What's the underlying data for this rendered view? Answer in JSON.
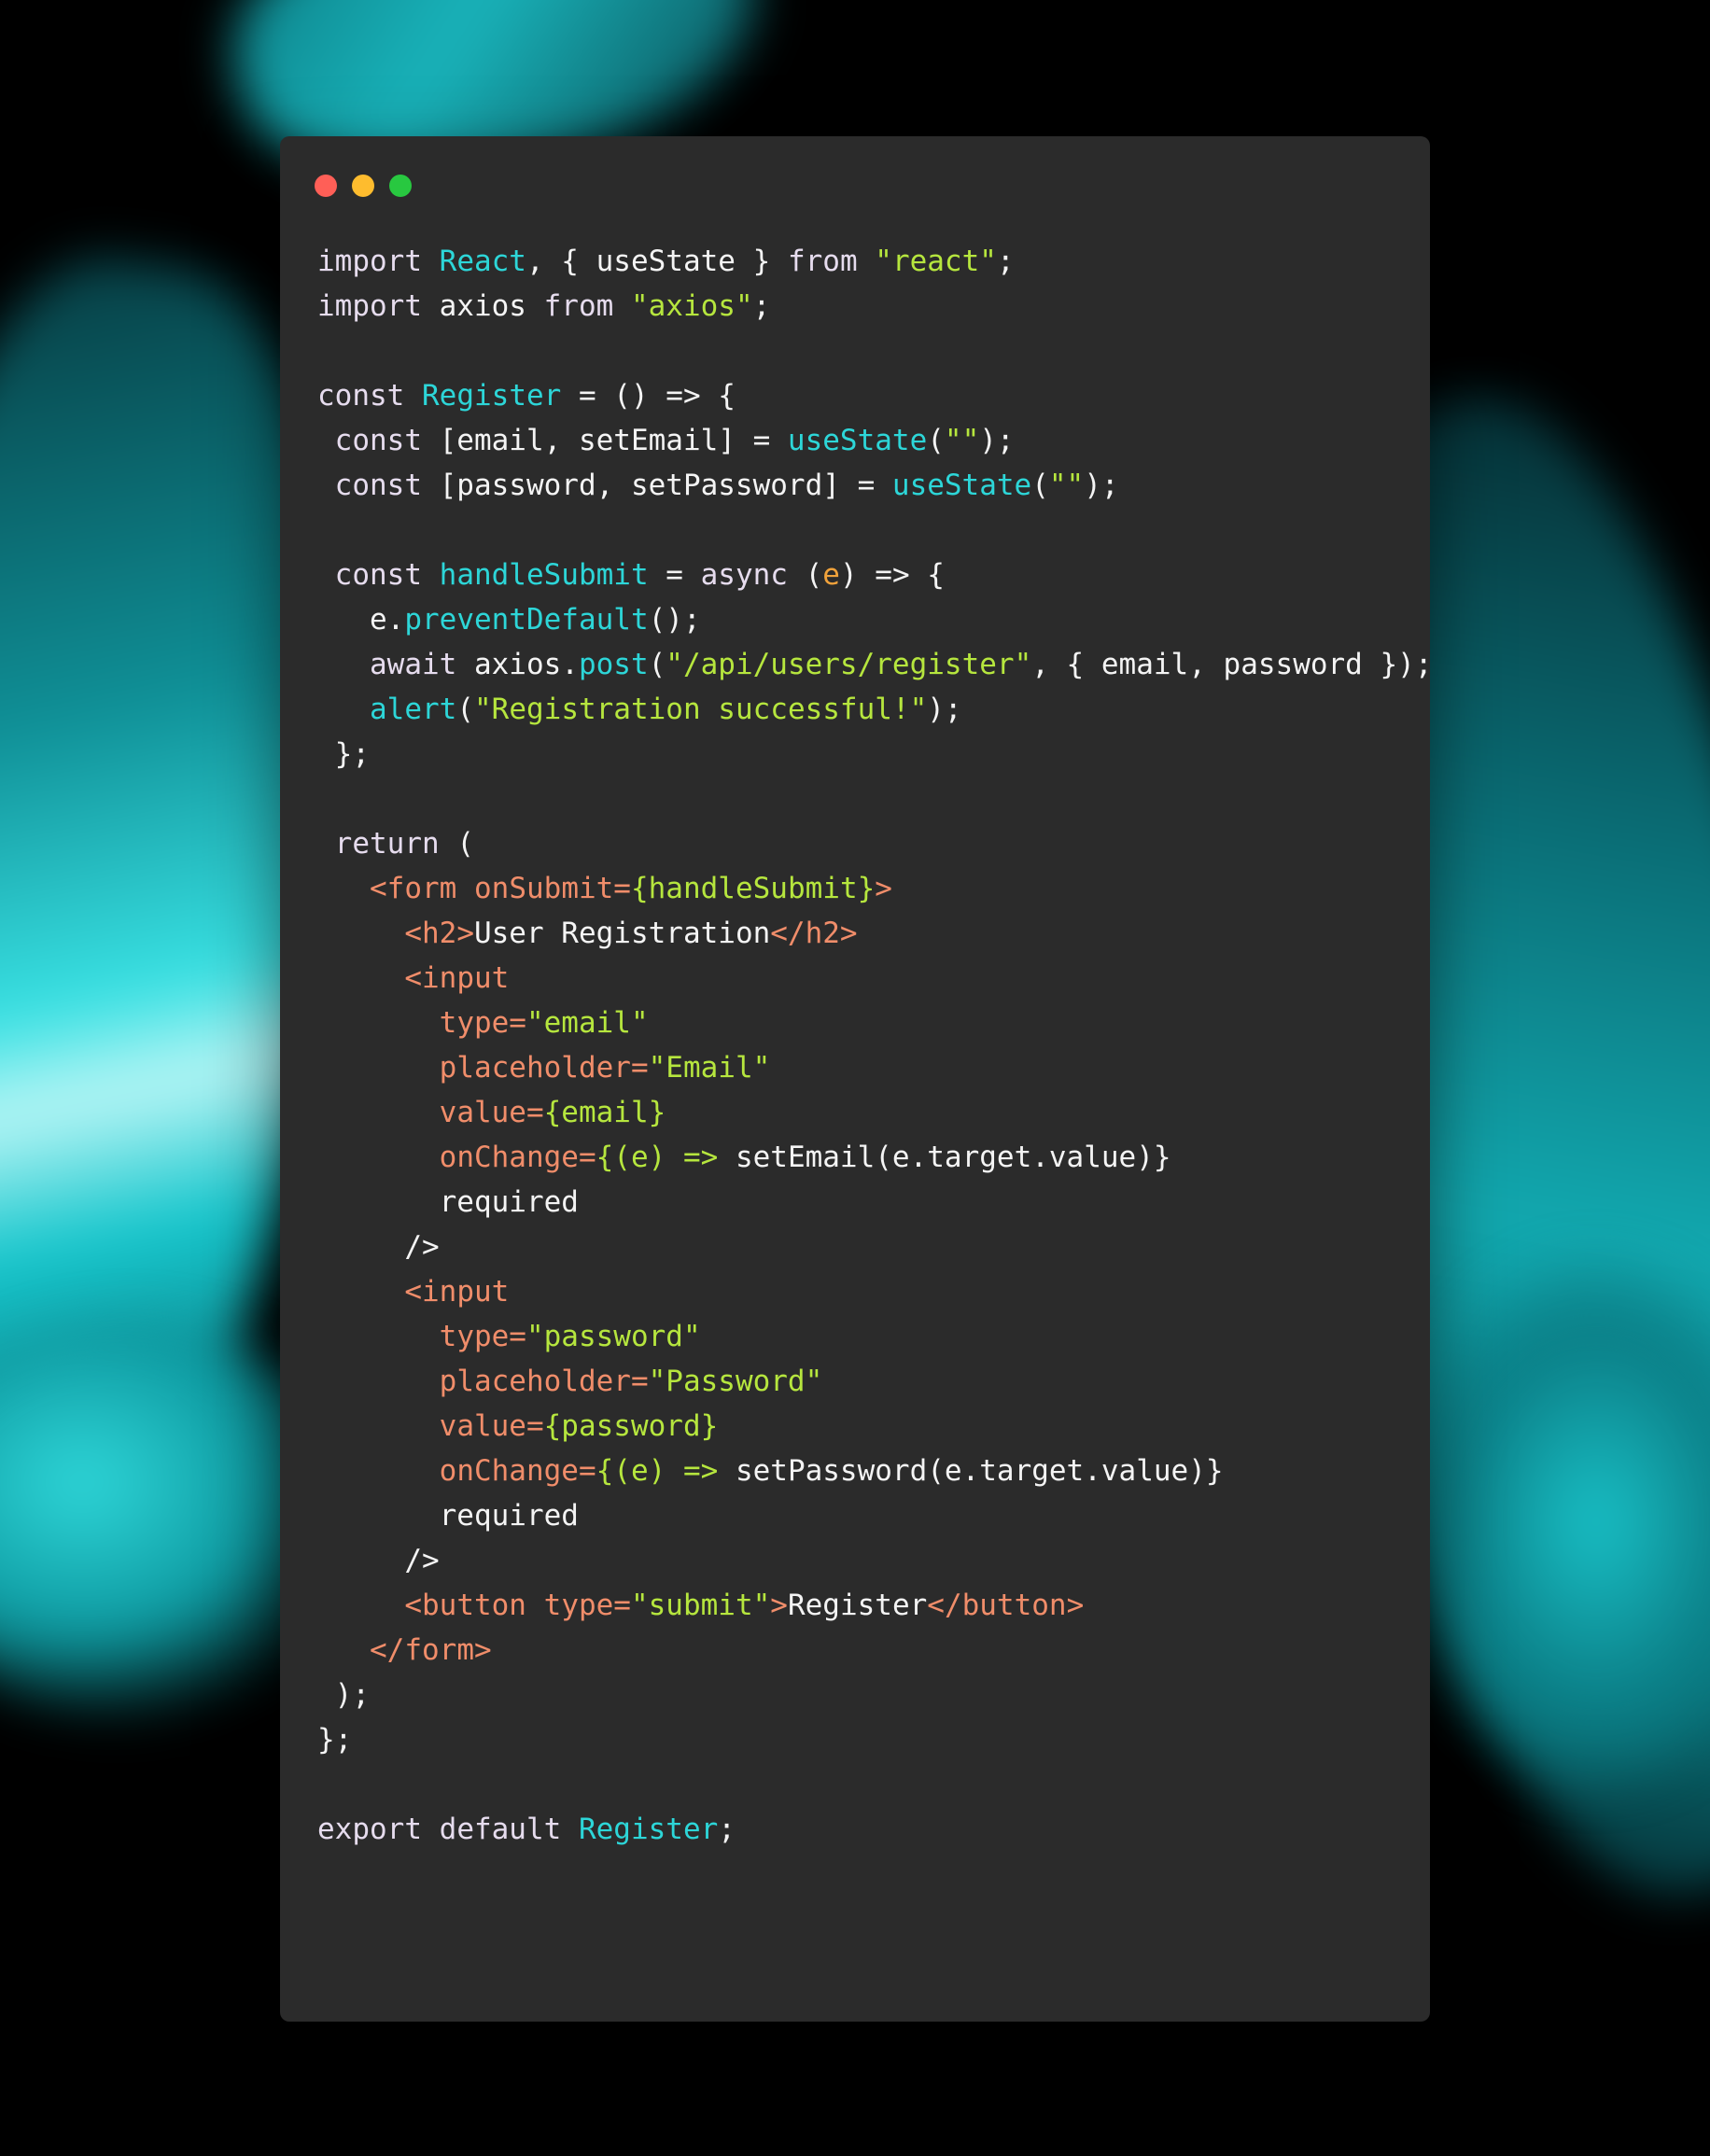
{
  "window": {
    "controls": [
      {
        "name": "close",
        "color": "#ff5f57"
      },
      {
        "name": "minimize",
        "color": "#febc2e"
      },
      {
        "name": "maximize",
        "color": "#28c840"
      }
    ]
  },
  "colors": {
    "background": "#2b2b2b",
    "keyword": "#e6dcee",
    "identifier_highlight": "#2dd6d8",
    "string": "#b6e63e",
    "parameter": "#f0a23b",
    "jsx_tag": "#f08d6a",
    "text": "#f4f4f4"
  },
  "code": {
    "lines": [
      [
        {
          "t": "import",
          "c": "kw"
        },
        {
          "t": " ",
          "c": "plain"
        },
        {
          "t": "React",
          "c": "cyan"
        },
        {
          "t": ", { useState } ",
          "c": "plain"
        },
        {
          "t": "from",
          "c": "kw"
        },
        {
          "t": " ",
          "c": "plain"
        },
        {
          "t": "\"react\"",
          "c": "str"
        },
        {
          "t": ";",
          "c": "plain"
        }
      ],
      [
        {
          "t": "import",
          "c": "kw"
        },
        {
          "t": " axios ",
          "c": "plain"
        },
        {
          "t": "from",
          "c": "kw"
        },
        {
          "t": " ",
          "c": "plain"
        },
        {
          "t": "\"axios\"",
          "c": "str"
        },
        {
          "t": ";",
          "c": "plain"
        }
      ],
      [],
      [
        {
          "t": "const",
          "c": "kw"
        },
        {
          "t": " ",
          "c": "plain"
        },
        {
          "t": "Register",
          "c": "cyan"
        },
        {
          "t": " = () => {",
          "c": "plain"
        }
      ],
      [
        {
          "t": " const",
          "c": "kw"
        },
        {
          "t": " [email, setEmail] = ",
          "c": "plain"
        },
        {
          "t": "useState",
          "c": "cyan"
        },
        {
          "t": "(",
          "c": "plain"
        },
        {
          "t": "\"\"",
          "c": "str"
        },
        {
          "t": ");",
          "c": "plain"
        }
      ],
      [
        {
          "t": " const",
          "c": "kw"
        },
        {
          "t": " [password, setPassword] = ",
          "c": "plain"
        },
        {
          "t": "useState",
          "c": "cyan"
        },
        {
          "t": "(",
          "c": "plain"
        },
        {
          "t": "\"\"",
          "c": "str"
        },
        {
          "t": ");",
          "c": "plain"
        }
      ],
      [],
      [
        {
          "t": " const",
          "c": "kw"
        },
        {
          "t": " ",
          "c": "plain"
        },
        {
          "t": "handleSubmit",
          "c": "cyan"
        },
        {
          "t": " = ",
          "c": "plain"
        },
        {
          "t": "async",
          "c": "kw"
        },
        {
          "t": " (",
          "c": "plain"
        },
        {
          "t": "e",
          "c": "param"
        },
        {
          "t": ") => {",
          "c": "plain"
        }
      ],
      [
        {
          "t": "   e.",
          "c": "plain"
        },
        {
          "t": "preventDefault",
          "c": "cyan"
        },
        {
          "t": "();",
          "c": "plain"
        }
      ],
      [
        {
          "t": "   await",
          "c": "kw"
        },
        {
          "t": " axios.",
          "c": "plain"
        },
        {
          "t": "post",
          "c": "cyan"
        },
        {
          "t": "(",
          "c": "plain"
        },
        {
          "t": "\"/api/users/register\"",
          "c": "str"
        },
        {
          "t": ", { email, password });",
          "c": "plain"
        }
      ],
      [
        {
          "t": "   ",
          "c": "plain"
        },
        {
          "t": "alert",
          "c": "cyan"
        },
        {
          "t": "(",
          "c": "plain"
        },
        {
          "t": "\"Registration successful!\"",
          "c": "str"
        },
        {
          "t": ");",
          "c": "plain"
        }
      ],
      [
        {
          "t": " };",
          "c": "plain"
        }
      ],
      [],
      [
        {
          "t": " return",
          "c": "kw"
        },
        {
          "t": " (",
          "c": "plain"
        }
      ],
      [
        {
          "t": "   ",
          "c": "plain"
        },
        {
          "t": "<form",
          "c": "tag"
        },
        {
          "t": " ",
          "c": "plain"
        },
        {
          "t": "onSubmit=",
          "c": "attr"
        },
        {
          "t": "{handleSubmit}",
          "c": "aval"
        },
        {
          "t": ">",
          "c": "tag"
        }
      ],
      [
        {
          "t": "     ",
          "c": "plain"
        },
        {
          "t": "<h2>",
          "c": "tag"
        },
        {
          "t": "User Registration",
          "c": "plain"
        },
        {
          "t": "</h2>",
          "c": "tag"
        }
      ],
      [
        {
          "t": "     ",
          "c": "plain"
        },
        {
          "t": "<input",
          "c": "tag"
        }
      ],
      [
        {
          "t": "       ",
          "c": "plain"
        },
        {
          "t": "type=",
          "c": "attr"
        },
        {
          "t": "\"email\"",
          "c": "aval"
        }
      ],
      [
        {
          "t": "       ",
          "c": "plain"
        },
        {
          "t": "placeholder=",
          "c": "attr"
        },
        {
          "t": "\"Email\"",
          "c": "aval"
        }
      ],
      [
        {
          "t": "       ",
          "c": "plain"
        },
        {
          "t": "value=",
          "c": "attr"
        },
        {
          "t": "{email}",
          "c": "aval"
        }
      ],
      [
        {
          "t": "       ",
          "c": "plain"
        },
        {
          "t": "onChange=",
          "c": "attr"
        },
        {
          "t": "{(e) => ",
          "c": "aval"
        },
        {
          "t": "setEmail(e.target.value)}",
          "c": "plain"
        }
      ],
      [
        {
          "t": "       required",
          "c": "plain"
        }
      ],
      [
        {
          "t": "     />",
          "c": "plain"
        }
      ],
      [
        {
          "t": "     ",
          "c": "plain"
        },
        {
          "t": "<input",
          "c": "tag"
        }
      ],
      [
        {
          "t": "       ",
          "c": "plain"
        },
        {
          "t": "type=",
          "c": "attr"
        },
        {
          "t": "\"password\"",
          "c": "aval"
        }
      ],
      [
        {
          "t": "       ",
          "c": "plain"
        },
        {
          "t": "placeholder=",
          "c": "attr"
        },
        {
          "t": "\"Password\"",
          "c": "aval"
        }
      ],
      [
        {
          "t": "       ",
          "c": "plain"
        },
        {
          "t": "value=",
          "c": "attr"
        },
        {
          "t": "{password}",
          "c": "aval"
        }
      ],
      [
        {
          "t": "       ",
          "c": "plain"
        },
        {
          "t": "onChange=",
          "c": "attr"
        },
        {
          "t": "{(e) => ",
          "c": "aval"
        },
        {
          "t": "setPassword(e.target.value)}",
          "c": "plain"
        }
      ],
      [
        {
          "t": "       required",
          "c": "plain"
        }
      ],
      [
        {
          "t": "     />",
          "c": "plain"
        }
      ],
      [
        {
          "t": "     ",
          "c": "plain"
        },
        {
          "t": "<button",
          "c": "tag"
        },
        {
          "t": " ",
          "c": "plain"
        },
        {
          "t": "type=",
          "c": "attr"
        },
        {
          "t": "\"submit\"",
          "c": "aval"
        },
        {
          "t": ">",
          "c": "tag"
        },
        {
          "t": "Register",
          "c": "plain"
        },
        {
          "t": "</button>",
          "c": "tag"
        }
      ],
      [
        {
          "t": "   ",
          "c": "plain"
        },
        {
          "t": "</form>",
          "c": "tag"
        }
      ],
      [
        {
          "t": " );",
          "c": "plain"
        }
      ],
      [
        {
          "t": "};",
          "c": "plain"
        }
      ],
      [],
      [
        {
          "t": "export",
          "c": "kw"
        },
        {
          "t": " ",
          "c": "plain"
        },
        {
          "t": "default",
          "c": "kw"
        },
        {
          "t": " ",
          "c": "plain"
        },
        {
          "t": "Register",
          "c": "cyan"
        },
        {
          "t": ";",
          "c": "plain"
        }
      ]
    ]
  }
}
